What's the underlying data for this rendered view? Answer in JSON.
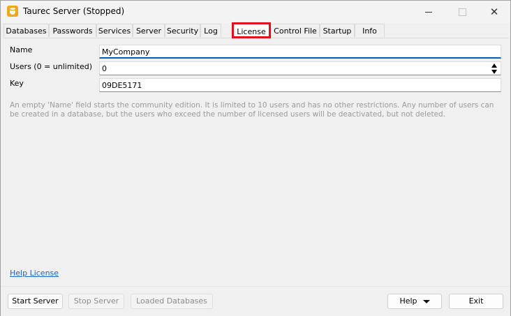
{
  "window": {
    "title": "Taurec Server (Stopped)"
  },
  "tabs": [
    {
      "label": "Databases"
    },
    {
      "label": "Passwords"
    },
    {
      "label": "Services"
    },
    {
      "label": "Server"
    },
    {
      "label": "Security"
    },
    {
      "label": "Log"
    },
    {
      "label": "License",
      "active": true
    },
    {
      "label": "Control File"
    },
    {
      "label": "Startup"
    },
    {
      "label": "Info"
    }
  ],
  "license": {
    "name_label": "Name",
    "name_value": "MyCompany",
    "users_label": "Users (0 = unlimited)",
    "users_value": "0",
    "key_label": "Key",
    "key_value": "09DE5171",
    "info_text": "An empty 'Name' field starts the community edition. It is limited to 10 users and has no other restrictions. Any number of users can be created in a database, but the users who exceed the number of licensed users will be deactivated, but not deleted.",
    "help_link": "Help License"
  },
  "buttons": {
    "start": "Start Server",
    "stop": "Stop Server",
    "loaded": "Loaded Databases",
    "help": "Help",
    "exit": "Exit"
  },
  "icons": {
    "app": "database-icon",
    "minimize": "minimize-icon",
    "maximize": "maximize-icon",
    "close": "close-icon",
    "spin": "spin-arrows-icon",
    "help_dropdown": "chevron-down-icon"
  },
  "colors": {
    "active_tab_highlight": "#e0101d",
    "link": "#1a66c8",
    "focus": "#005fb8"
  }
}
